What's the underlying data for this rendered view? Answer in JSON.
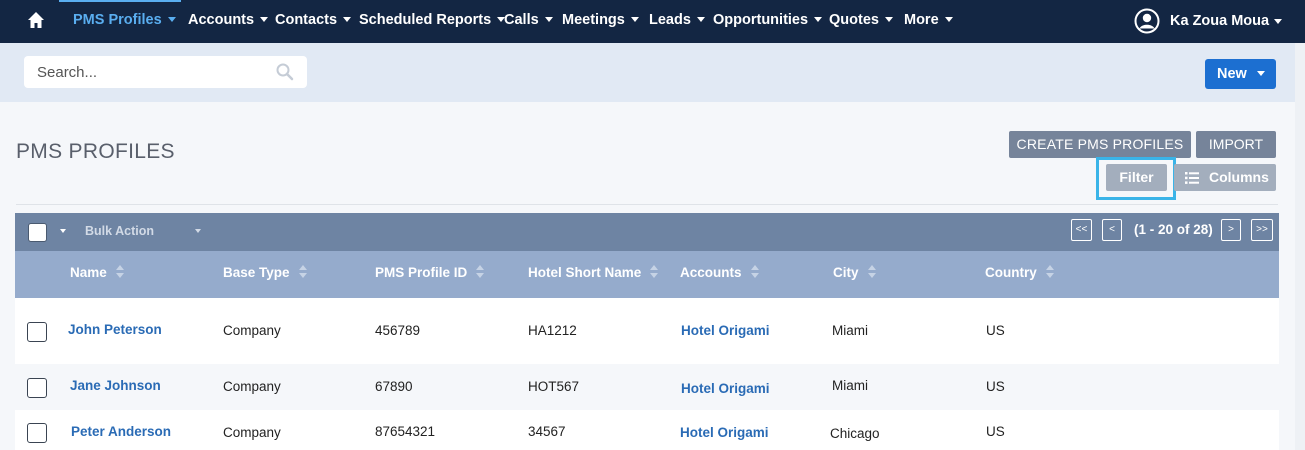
{
  "nav": {
    "items": [
      {
        "label": "PMS Profiles",
        "active": true
      },
      {
        "label": "Accounts"
      },
      {
        "label": "Contacts"
      },
      {
        "label": "Scheduled Reports"
      },
      {
        "label": "Calls"
      },
      {
        "label": "Meetings"
      },
      {
        "label": "Leads"
      },
      {
        "label": "Opportunities"
      },
      {
        "label": "Quotes"
      },
      {
        "label": "More"
      }
    ],
    "user_name": "Ka Zoua Moua"
  },
  "search": {
    "placeholder": "Search..."
  },
  "new_button": "New",
  "page": {
    "title": "PMS PROFILES",
    "create_button": "CREATE PMS PROFILES",
    "import_button": "IMPORT",
    "filter_button": "Filter",
    "columns_button": "Columns"
  },
  "toolbar": {
    "bulk_action": "Bulk Action",
    "first": "<<",
    "prev": "<",
    "next": ">",
    "last": ">>",
    "count": "(1 - 20 of 28)"
  },
  "table": {
    "columns": [
      "Name",
      "Base Type",
      "PMS Profile ID",
      "Hotel Short Name",
      "Accounts",
      "City",
      "Country"
    ],
    "rows": [
      {
        "name": "John Peterson",
        "base_type": "Company",
        "profile_id": "456789",
        "hotel_short": "HA1212",
        "account": "Hotel Origami",
        "city": "Miami",
        "country": "US"
      },
      {
        "name": "Jane Johnson",
        "base_type": "Company",
        "profile_id": "67890",
        "hotel_short": "HOT567",
        "account": "Hotel Origami",
        "city": "Miami",
        "country": "US"
      },
      {
        "name": "Peter Anderson",
        "base_type": "Company",
        "profile_id": "87654321",
        "hotel_short": "34567",
        "account": "Hotel Origami",
        "city": "Chicago",
        "country": "US"
      }
    ]
  },
  "colors": {
    "nav_bg": "#132643",
    "accent": "#5aaef0",
    "primary": "#1c6fd1",
    "toolbar": "#6e84a3",
    "header": "#95abcc",
    "link": "#2a6bb5",
    "highlight": "#3ab4e8"
  }
}
